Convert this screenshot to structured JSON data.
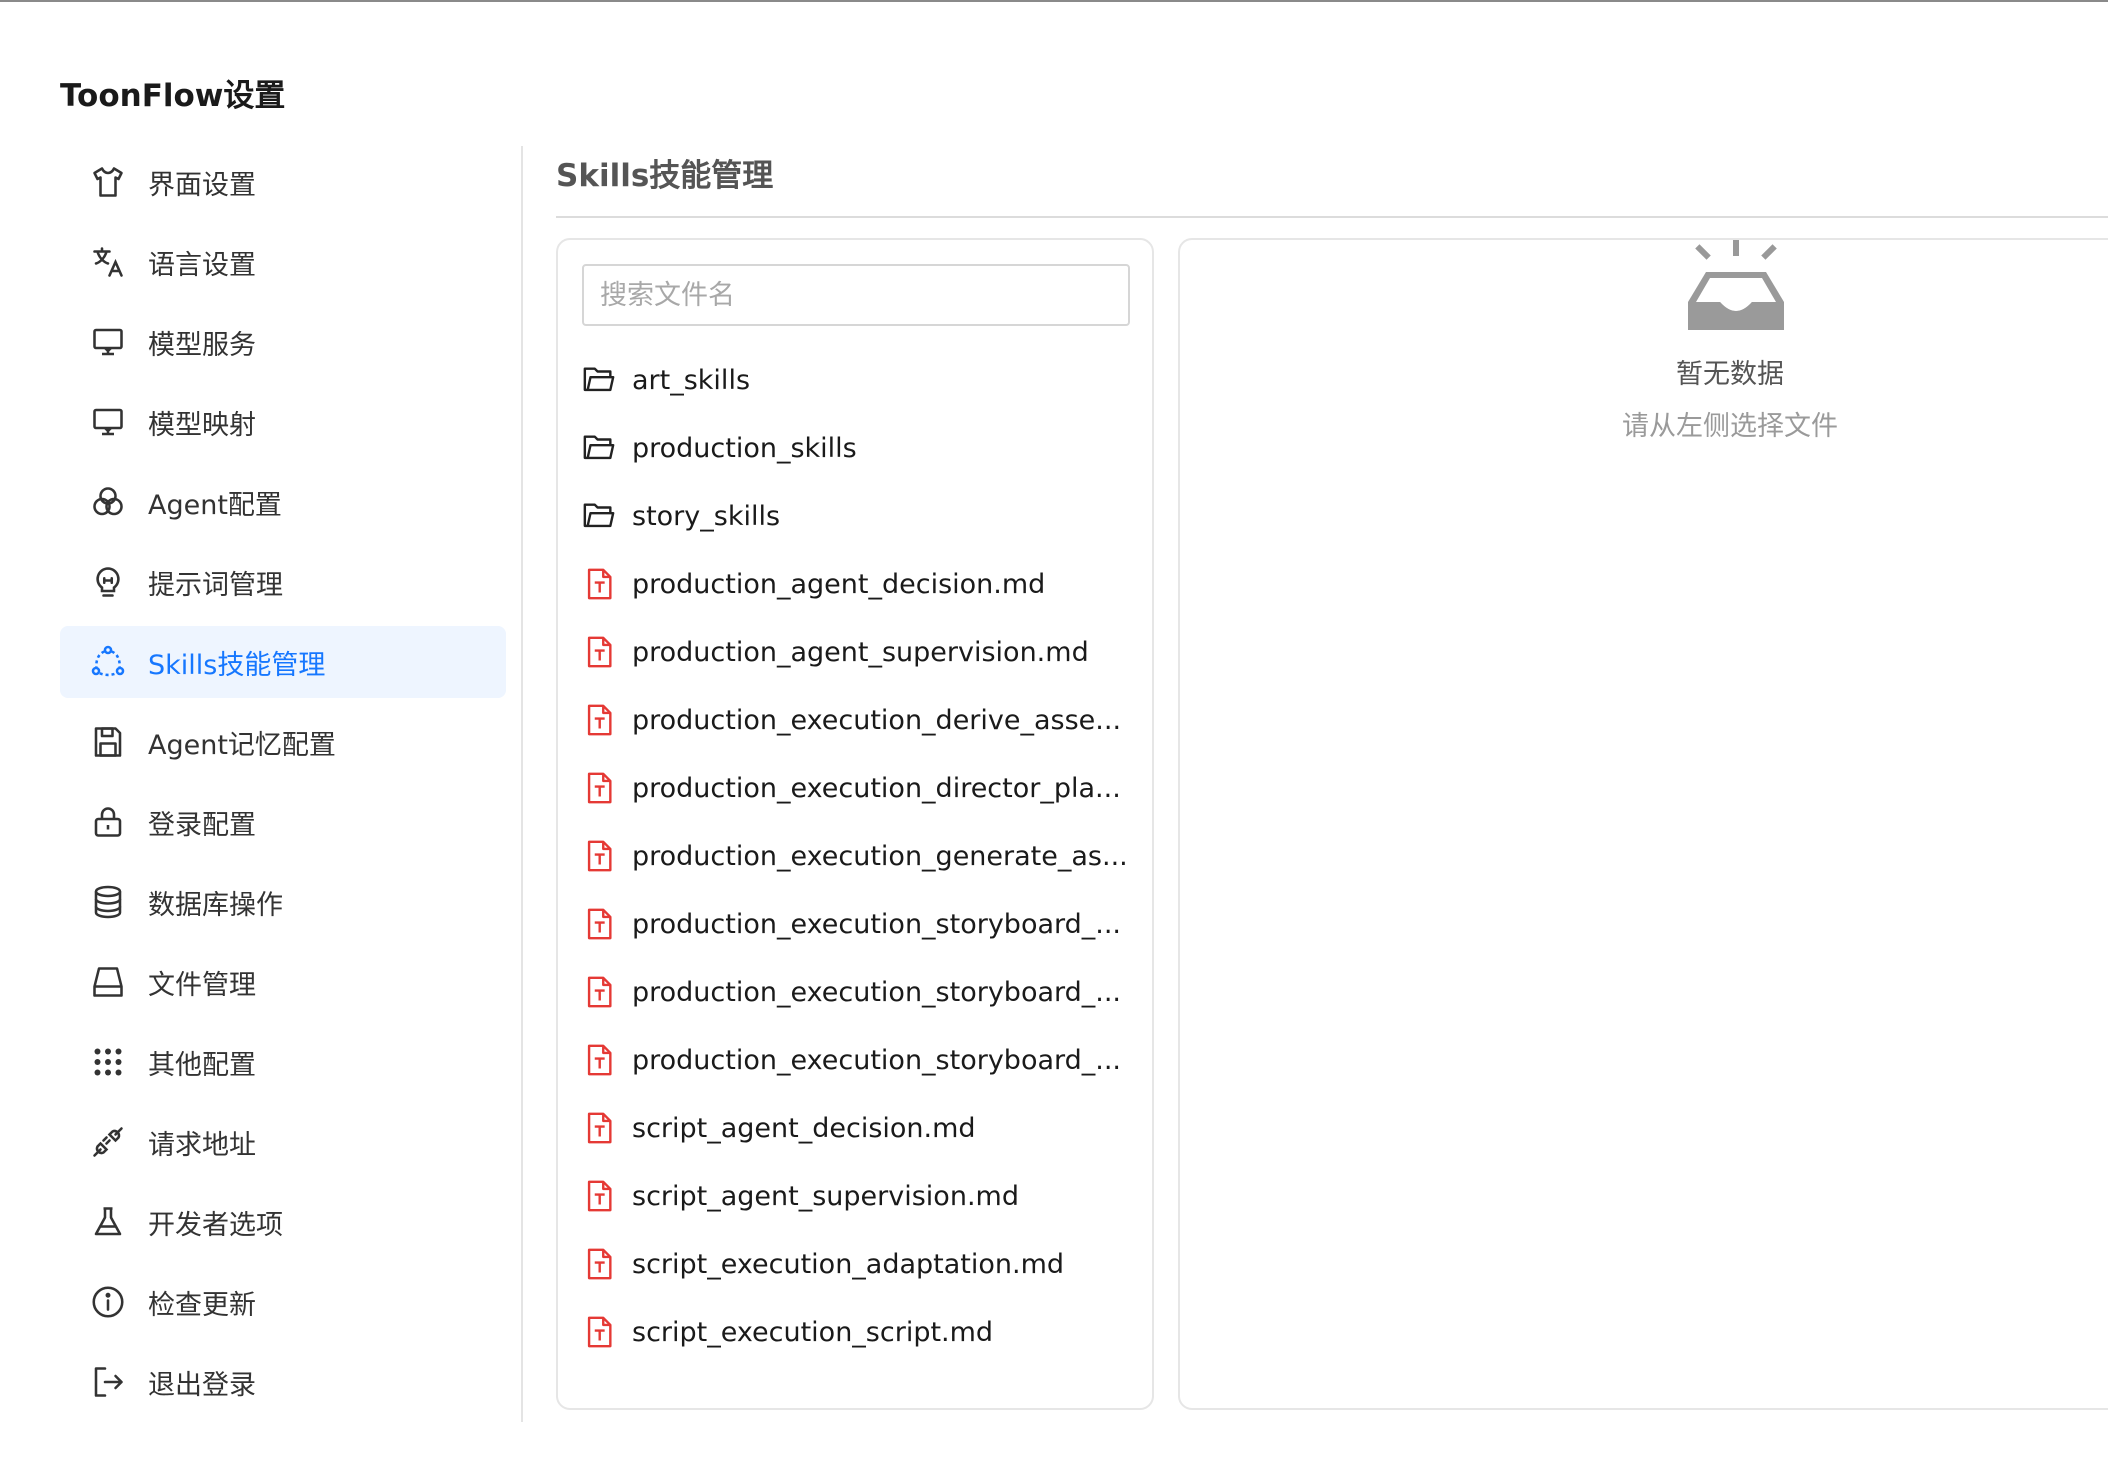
{
  "app": {
    "title": "ToonFlow设置"
  },
  "sidebar": {
    "items": [
      {
        "label": "界面设置",
        "icon": "shirt-icon"
      },
      {
        "label": "语言设置",
        "icon": "translate-icon"
      },
      {
        "label": "模型服务",
        "icon": "monitor-icon"
      },
      {
        "label": "模型映射",
        "icon": "monitor-icon"
      },
      {
        "label": "Agent配置",
        "icon": "circles-icon"
      },
      {
        "label": "提示词管理",
        "icon": "bulb-icon"
      },
      {
        "label": "Skills技能管理",
        "icon": "nodes-icon",
        "active": true
      },
      {
        "label": "Agent记忆配置",
        "icon": "save-icon"
      },
      {
        "label": "登录配置",
        "icon": "lock-icon"
      },
      {
        "label": "数据库操作",
        "icon": "database-icon"
      },
      {
        "label": "文件管理",
        "icon": "drive-icon"
      },
      {
        "label": "其他配置",
        "icon": "dots-grid-icon"
      },
      {
        "label": "请求地址",
        "icon": "plug-icon"
      },
      {
        "label": "开发者选项",
        "icon": "flask-icon"
      },
      {
        "label": "检查更新",
        "icon": "info-icon"
      },
      {
        "label": "退出登录",
        "icon": "logout-icon"
      }
    ]
  },
  "main": {
    "title": "Skills技能管理",
    "search": {
      "placeholder": "搜索文件名",
      "value": ""
    },
    "files": [
      {
        "name": "art_skills",
        "type": "folder"
      },
      {
        "name": "production_skills",
        "type": "folder"
      },
      {
        "name": "story_skills",
        "type": "folder"
      },
      {
        "name": "production_agent_decision.md",
        "type": "file"
      },
      {
        "name": "production_agent_supervision.md",
        "type": "file"
      },
      {
        "name": "production_execution_derive_asse...",
        "type": "file"
      },
      {
        "name": "production_execution_director_pla...",
        "type": "file"
      },
      {
        "name": "production_execution_generate_as...",
        "type": "file"
      },
      {
        "name": "production_execution_storyboard_...",
        "type": "file"
      },
      {
        "name": "production_execution_storyboard_...",
        "type": "file"
      },
      {
        "name": "production_execution_storyboard_...",
        "type": "file"
      },
      {
        "name": "script_agent_decision.md",
        "type": "file"
      },
      {
        "name": "script_agent_supervision.md",
        "type": "file"
      },
      {
        "name": "script_execution_adaptation.md",
        "type": "file"
      },
      {
        "name": "script_execution_script.md",
        "type": "file"
      }
    ],
    "empty": {
      "title": "暂无数据",
      "subtitle": "请从左侧选择文件",
      "icon": "empty-inbox-icon"
    }
  },
  "colors": {
    "accent": "#1677ff",
    "active_bg": "#eef5ff",
    "file_icon": "#e53935"
  }
}
